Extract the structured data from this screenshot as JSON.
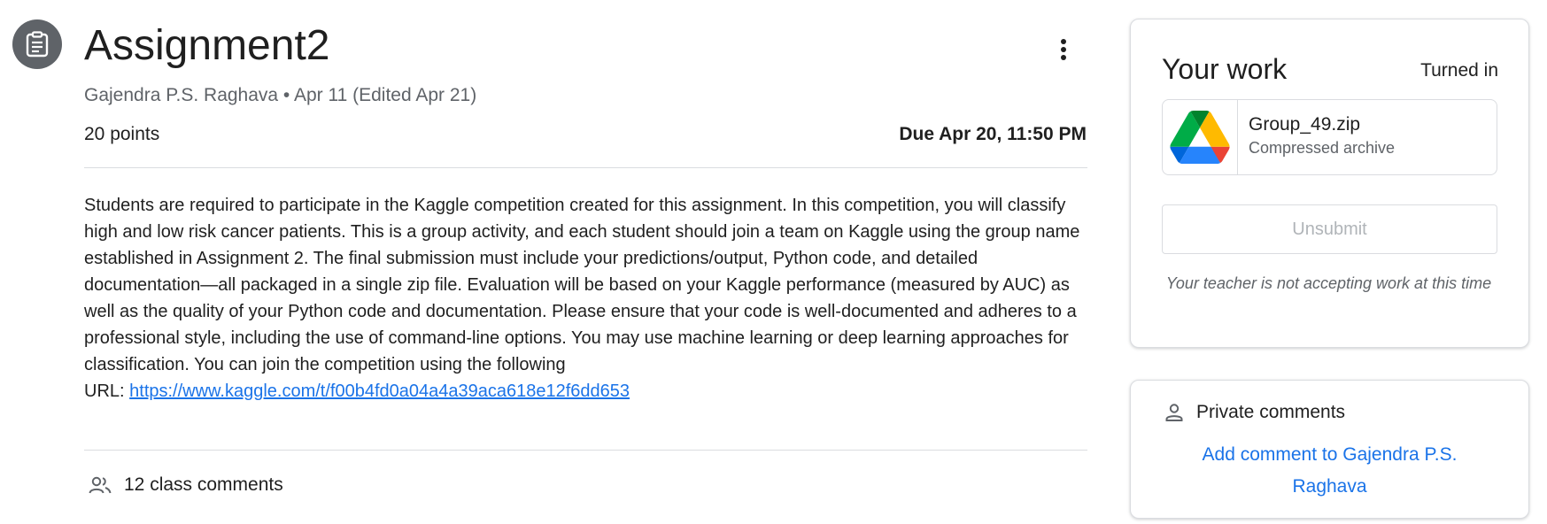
{
  "assignment": {
    "title": "Assignment2",
    "meta": "Gajendra P.S. Raghava • Apr 11 (Edited Apr 21)",
    "points": "20 points",
    "due": "Due Apr 20, 11:50 PM",
    "description": "Students are required to participate in the Kaggle competition created for this assignment. In this competition, you will classify high and low risk cancer patients. This is a group activity, and each student should join a team on Kaggle using the group name established in Assignment 2. The final submission must include your predictions/output, Python code, and detailed documentation—all packaged in a single zip file. Evaluation will be based on your Kaggle performance (measured by AUC) as well as the quality of your Python code and documentation. Please ensure that your code is well-documented and adheres to a professional style, including the use of command-line options. You may use machine learning or deep learning approaches for classification. You can join the competition using the following",
    "url_label": "URL:",
    "url": "https://www.kaggle.com/t/f00b4fd0a04a4a39aca618e12f6dd653",
    "class_comments": "12 class comments"
  },
  "your_work": {
    "title": "Your work",
    "status": "Turned in",
    "file_name": "Group_49.zip",
    "file_type": "Compressed archive",
    "unsubmit_label": "Unsubmit",
    "notice": "Your teacher is not accepting work at this time"
  },
  "private_comments": {
    "title": "Private comments",
    "add_label": "Add comment to Gajendra P.S. Raghava"
  },
  "icons": {
    "assignment": "assignment-icon",
    "more": "more-vert-icon",
    "class_comments": "people-icon",
    "private_comments": "person-icon",
    "drive": "google-drive-icon"
  },
  "colors": {
    "link": "#1a73e8",
    "icon_circle": "#5f6368",
    "muted_text": "#5f6368"
  }
}
